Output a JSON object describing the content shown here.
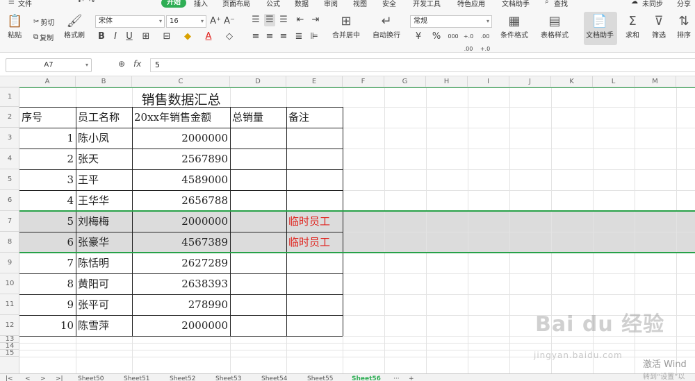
{
  "menu": {
    "hamburger_icon": "menu-icon",
    "file": "文件",
    "tabs": [
      "开始",
      "插入",
      "页面布局",
      "公式",
      "数据",
      "审阅",
      "视图",
      "安全",
      "开发工具",
      "特色应用",
      "文档助手"
    ],
    "search": "查找",
    "sync": "未同步",
    "share": "分享"
  },
  "ribbon": {
    "paste": "粘贴",
    "cut": "剪切",
    "copy": "复制",
    "format_painter": "格式刷",
    "font_name": "宋体",
    "font_size": "16",
    "bold": "B",
    "italic": "I",
    "underline": "U",
    "merge_center": "合并居中",
    "wrap_text": "自动换行",
    "number_format": "常规",
    "percent": "%",
    "thousands": "000",
    "inc_decimal": "+.0 .00",
    "dec_decimal": ".00 +.0",
    "conditional_format": "条件格式",
    "table_style": "表格样式",
    "doc_assistant": "文档助手",
    "sum": "求和",
    "filter": "筛选",
    "sort": "排序"
  },
  "formula_bar": {
    "cell_ref": "A7",
    "fx": "fx",
    "value": "5"
  },
  "columns": [
    "A",
    "B",
    "C",
    "D",
    "E",
    "F",
    "G",
    "H",
    "I",
    "J",
    "K",
    "L",
    "M"
  ],
  "rows": [
    "1",
    "2",
    "3",
    "4",
    "5",
    "6",
    "7",
    "8",
    "9",
    "10",
    "11",
    "12",
    "13",
    "14",
    "15"
  ],
  "table": {
    "title": "销售数据汇总",
    "headers": [
      "序号",
      "员工名称",
      "20xx年销售金额",
      "总销量",
      "备注"
    ],
    "data": [
      [
        "1",
        "陈小凤",
        "2000000",
        "",
        ""
      ],
      [
        "2",
        "张天",
        "2567890",
        "",
        ""
      ],
      [
        "3",
        "王平",
        "4589000",
        "",
        ""
      ],
      [
        "4",
        "王华华",
        "2656788",
        "",
        ""
      ],
      [
        "5",
        "刘梅梅",
        "2000000",
        "",
        "临时员工"
      ],
      [
        "6",
        "张豪华",
        "4567389",
        "",
        "临时员工"
      ],
      [
        "7",
        "陈恬明",
        "2627289",
        "",
        ""
      ],
      [
        "8",
        "黄阳可",
        "2638393",
        "",
        ""
      ],
      [
        "9",
        "张平可",
        "278990",
        "",
        ""
      ],
      [
        "10",
        "陈雪萍",
        "2000000",
        "",
        ""
      ]
    ]
  },
  "sheet_tabs": [
    "Sheet50",
    "Sheet51",
    "Sheet52",
    "Sheet53",
    "Sheet54",
    "Sheet55",
    "Sheet56"
  ],
  "active_sheet": "Sheet56",
  "more_tabs": "···",
  "add_tab": "+",
  "watermark": {
    "main": "Bai du 经验",
    "sub": "jingyan.baidu.com"
  },
  "activate": {
    "line1": "激活 Wind",
    "line2": "转到“设置”以"
  },
  "colors": {
    "accent": "#2fae55",
    "red_text": "#e0221d",
    "selection": "#27a148"
  }
}
